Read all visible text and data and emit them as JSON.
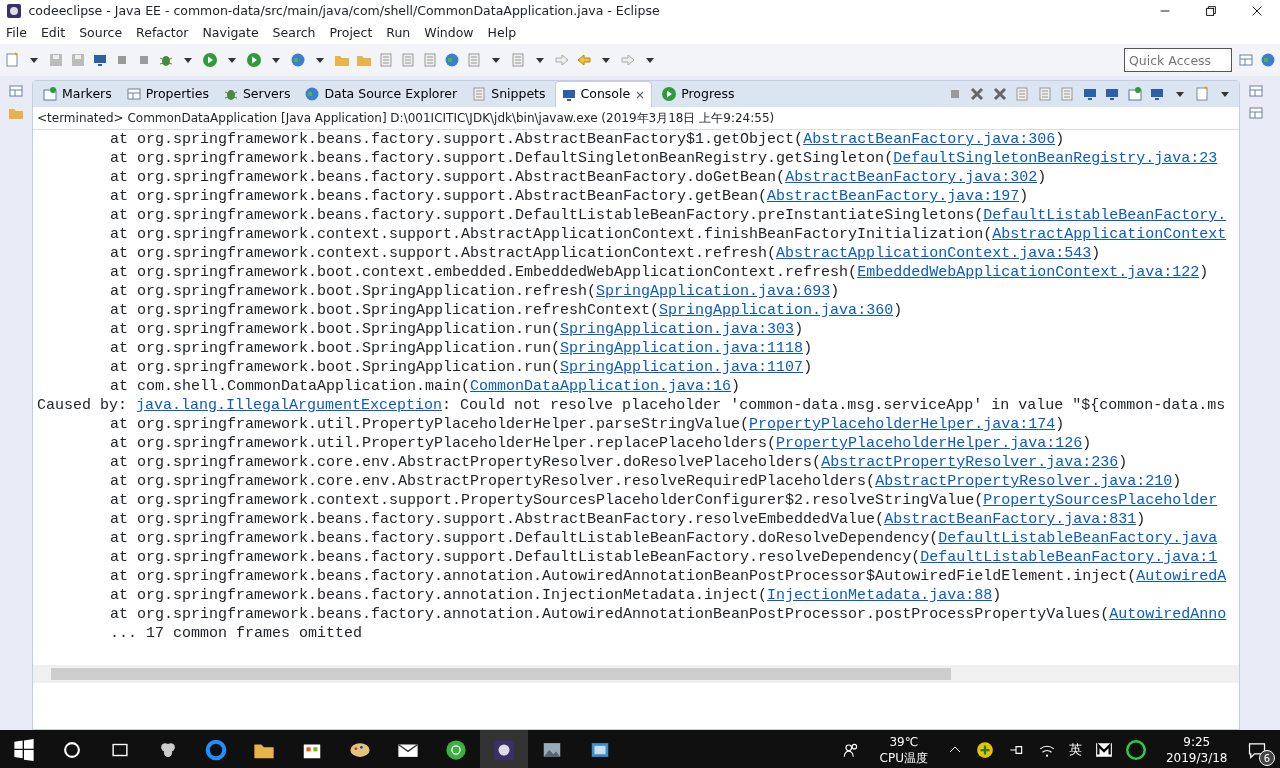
{
  "window": {
    "title": "codeeclipse - Java EE - common-data/src/main/java/com/shell/CommonDataApplication.java - Eclipse"
  },
  "menu": [
    "File",
    "Edit",
    "Source",
    "Refactor",
    "Navigate",
    "Search",
    "Project",
    "Run",
    "Window",
    "Help"
  ],
  "quick_access": {
    "placeholder": "Quick Access"
  },
  "view_tabs": [
    {
      "label": "Markers",
      "selected": false
    },
    {
      "label": "Properties",
      "selected": false
    },
    {
      "label": "Servers",
      "selected": false
    },
    {
      "label": "Data Source Explorer",
      "selected": false
    },
    {
      "label": "Snippets",
      "selected": false
    },
    {
      "label": "Console",
      "selected": true
    },
    {
      "label": "Progress",
      "selected": false
    }
  ],
  "console": {
    "header": "<terminated> CommonDataApplication [Java Application] D:\\001ICITIC\\JDK\\jdk\\bin\\javaw.exe (2019年3月18日 上午9:24:55)",
    "lines": [
      {
        "kind": "frame",
        "text": "at org.springframework.beans.factory.support.AbstractBeanFactory$1.getObject(",
        "link": "AbstractBeanFactory.java:306",
        "suffix": ")"
      },
      {
        "kind": "frame",
        "text": "at org.springframework.beans.factory.support.DefaultSingletonBeanRegistry.getSingleton(",
        "link": "DefaultSingletonBeanRegistry.java:23"
      },
      {
        "kind": "frame",
        "text": "at org.springframework.beans.factory.support.AbstractBeanFactory.doGetBean(",
        "link": "AbstractBeanFactory.java:302",
        "suffix": ")"
      },
      {
        "kind": "frame",
        "text": "at org.springframework.beans.factory.support.AbstractBeanFactory.getBean(",
        "link": "AbstractBeanFactory.java:197",
        "suffix": ")"
      },
      {
        "kind": "frame",
        "text": "at org.springframework.beans.factory.support.DefaultListableBeanFactory.preInstantiateSingletons(",
        "link": "DefaultListableBeanFactory."
      },
      {
        "kind": "frame",
        "text": "at org.springframework.context.support.AbstractApplicationContext.finishBeanFactoryInitialization(",
        "link": "AbstractApplicationContext"
      },
      {
        "kind": "frame",
        "text": "at org.springframework.context.support.AbstractApplicationContext.refresh(",
        "link": "AbstractApplicationContext.java:543",
        "suffix": ")"
      },
      {
        "kind": "frame",
        "text": "at org.springframework.boot.context.embedded.EmbeddedWebApplicationContext.refresh(",
        "link": "EmbeddedWebApplicationContext.java:122",
        "suffix": ")"
      },
      {
        "kind": "frame",
        "text": "at org.springframework.boot.SpringApplication.refresh(",
        "link": "SpringApplication.java:693",
        "suffix": ")"
      },
      {
        "kind": "frame",
        "text": "at org.springframework.boot.SpringApplication.refreshContext(",
        "link": "SpringApplication.java:360",
        "suffix": ")"
      },
      {
        "kind": "frame",
        "text": "at org.springframework.boot.SpringApplication.run(",
        "link": "SpringApplication.java:303",
        "suffix": ")"
      },
      {
        "kind": "frame",
        "text": "at org.springframework.boot.SpringApplication.run(",
        "link": "SpringApplication.java:1118",
        "suffix": ")"
      },
      {
        "kind": "frame",
        "text": "at org.springframework.boot.SpringApplication.run(",
        "link": "SpringApplication.java:1107",
        "suffix": ")"
      },
      {
        "kind": "frame",
        "text": "at com.shell.CommonDataApplication.main(",
        "link": "CommonDataApplication.java:16",
        "suffix": ")"
      },
      {
        "kind": "caused",
        "text": "Caused by: ",
        "link": "java.lang.IllegalArgumentException",
        "suffix": ": Could not resolve placeholder 'common-data.msg.serviceApp' in value \"${common-data.ms"
      },
      {
        "kind": "frame",
        "text": "at org.springframework.util.PropertyPlaceholderHelper.parseStringValue(",
        "link": "PropertyPlaceholderHelper.java:174",
        "suffix": ")"
      },
      {
        "kind": "frame",
        "text": "at org.springframework.util.PropertyPlaceholderHelper.replacePlaceholders(",
        "link": "PropertyPlaceholderHelper.java:126",
        "suffix": ")"
      },
      {
        "kind": "frame",
        "text": "at org.springframework.core.env.AbstractPropertyResolver.doResolvePlaceholders(",
        "link": "AbstractPropertyResolver.java:236",
        "suffix": ")"
      },
      {
        "kind": "frame",
        "text": "at org.springframework.core.env.AbstractPropertyResolver.resolveRequiredPlaceholders(",
        "link": "AbstractPropertyResolver.java:210",
        "suffix": ")"
      },
      {
        "kind": "frame",
        "text": "at org.springframework.context.support.PropertySourcesPlaceholderConfigurer$2.resolveStringValue(",
        "link": "PropertySourcesPlaceholder"
      },
      {
        "kind": "frame",
        "text": "at org.springframework.beans.factory.support.AbstractBeanFactory.resolveEmbeddedValue(",
        "link": "AbstractBeanFactory.java:831",
        "suffix": ")"
      },
      {
        "kind": "frame",
        "text": "at org.springframework.beans.factory.support.DefaultListableBeanFactory.doResolveDependency(",
        "link": "DefaultListableBeanFactory.java"
      },
      {
        "kind": "frame",
        "text": "at org.springframework.beans.factory.support.DefaultListableBeanFactory.resolveDependency(",
        "link": "DefaultListableBeanFactory.java:1"
      },
      {
        "kind": "frame",
        "text": "at org.springframework.beans.factory.annotation.AutowiredAnnotationBeanPostProcessor$AutowiredFieldElement.inject(",
        "link": "AutowiredA"
      },
      {
        "kind": "frame",
        "text": "at org.springframework.beans.factory.annotation.InjectionMetadata.inject(",
        "link": "InjectionMetadata.java:88",
        "suffix": ")"
      },
      {
        "kind": "frame",
        "text": "at org.springframework.beans.factory.annotation.AutowiredAnnotationBeanPostProcessor.postProcessPropertyValues(",
        "link": "AutowiredAnno"
      },
      {
        "kind": "frame",
        "text": "... 17 common frames omitted"
      }
    ]
  },
  "taskbar": {
    "temperature": "39℃",
    "temperature_label": "CPU温度",
    "ime": "英",
    "time": "9:25",
    "date": "2019/3/18",
    "notifications": "6"
  }
}
